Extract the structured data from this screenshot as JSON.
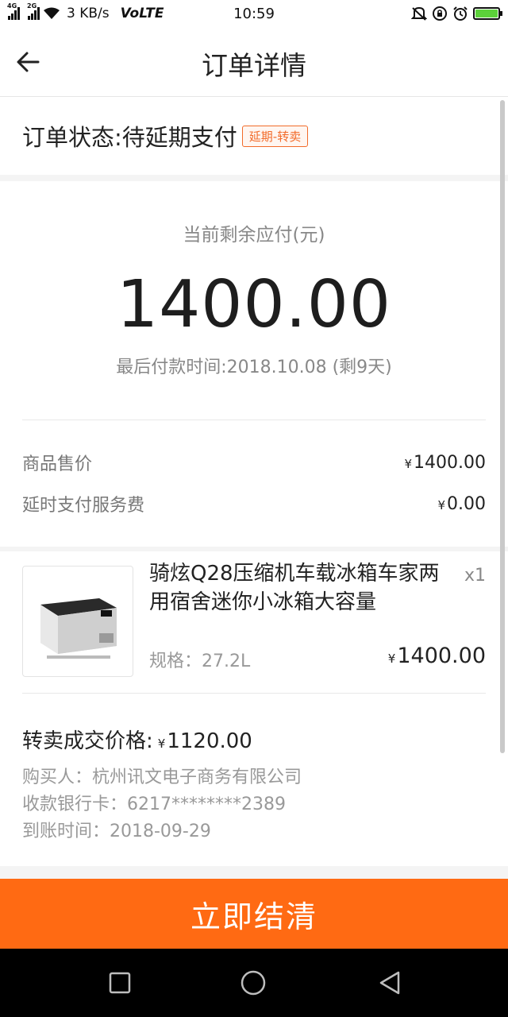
{
  "status_bar": {
    "net1": "4G",
    "net2": "2G",
    "speed": "3 KB/s",
    "volte": "VoLTE",
    "time": "10:59"
  },
  "header": {
    "title": "订单详情",
    "back_icon": "back-arrow-icon"
  },
  "order_status": {
    "label": "订单状态:待延期支付",
    "badge": "延期-转卖"
  },
  "payment": {
    "remaining_label": "当前剩余应付(元)",
    "amount": "1400.00",
    "deadline": "最后付款时间:2018.10.08 (剩9天)"
  },
  "price_rows": [
    {
      "label": "商品售价",
      "currency": "¥",
      "value": "1400.00"
    },
    {
      "label": "延时支付服务费",
      "currency": "¥",
      "value": "0.00"
    }
  ],
  "product": {
    "name": "骑炫Q28压缩机车载冰箱车家两用宿舍迷你小冰箱大容量",
    "qty": "x1",
    "spec": "规格：27.2L",
    "currency": "¥",
    "price": "1400.00"
  },
  "resale": {
    "title": "转卖成交价格:",
    "currency": "¥",
    "price": "1120.00",
    "buyer": "购买人：杭州讯文电子商务有限公司",
    "bank_card": "收款银行卡：6217********2389",
    "arrival": "到账时间：2018-09-29"
  },
  "action": {
    "settle_label": "立即结清"
  },
  "colors": {
    "accent": "#ff6a13",
    "badge": "#f26b2a",
    "battery": "#5cd13a"
  }
}
